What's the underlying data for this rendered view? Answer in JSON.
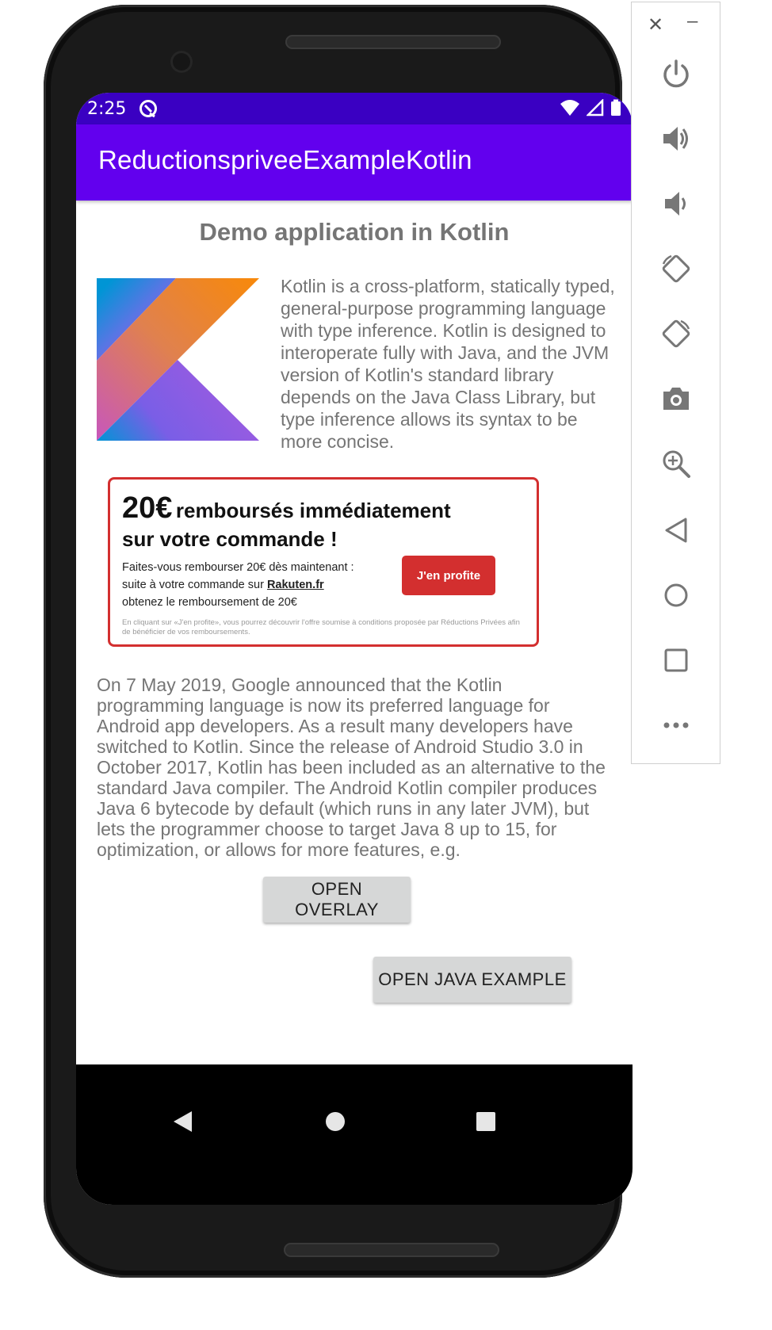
{
  "status_bar": {
    "time": "2:25"
  },
  "app_bar": {
    "title": "ReductionspriveeExampleKotlin"
  },
  "main": {
    "title": "Demo application in Kotlin",
    "intro_text": "Kotlin is a cross-platform, statically typed, general-purpose programming language with type inference. Kotlin is designed to interoperate fully with Java, and the JVM version of Kotlin's standard library depends on the Java Class Library, but type inference allows its syntax to be more concise.",
    "ad": {
      "amount": "20€",
      "headline_1": "remboursés immédiatement",
      "headline_2": "sur votre commande !",
      "body_line_1": "Faites-vous rembourser 20€ dès maintenant :",
      "body_line_2_prefix": "suite à votre commande sur",
      "body_line_2_link": "Rakuten.fr",
      "body_line_3": "obtenez le remboursement de 20€",
      "cta_label": "J'en profite",
      "fine_print": "En cliquant sur «J'en profite», vous pourrez découvrir l'offre soumise à conditions proposée par Réductions Privées afin de bénéficier de vos remboursements.",
      "accent_color": "#d32f2f"
    },
    "body_text": "On 7 May 2019, Google announced that the Kotlin programming language is now its preferred language for Android app developers. As a result many developers have switched to Kotlin. Since the release of Android Studio 3.0 in October 2017, Kotlin has been included as an alternative to the standard Java compiler. The Android Kotlin compiler produces Java 6 bytecode by default (which runs in any later JVM), but lets the programmer choose to target Java 8 up to 15, for optimization, or allows for more features, e.g.",
    "open_overlay_label": "OPEN OVERLAY",
    "open_java_label": "OPEN JAVA EXAMPLE"
  },
  "colors": {
    "app_bar": "#6200ee",
    "status_bar": "#3a00c2",
    "button_bg": "#d6d7d7",
    "text_grey": "#757575"
  },
  "emulator_toolbar": {
    "items": [
      "power-icon",
      "volume-up-icon",
      "volume-down-icon",
      "rotate-left-icon",
      "rotate-right-icon",
      "camera-icon",
      "zoom-icon",
      "back-icon",
      "home-icon",
      "overview-icon",
      "more-icon"
    ]
  }
}
